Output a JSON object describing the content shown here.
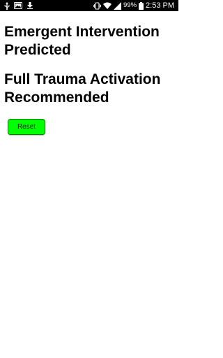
{
  "status_bar": {
    "battery_percent": "99%",
    "time": "2:53 PM",
    "icons_left": [
      "usb-icon",
      "image-icon",
      "download-icon"
    ],
    "icons_right": [
      "vibrate-icon",
      "wifi-icon",
      "signal-icon",
      "battery-icon"
    ]
  },
  "main": {
    "heading_1": "Emergent Intervention Predicted",
    "heading_2": "Full Trauma Activation Recommended",
    "reset_label": "Reset"
  },
  "colors": {
    "reset_button_bg": "#00ff00",
    "status_bar_bg": "#000000",
    "text": "#000000"
  }
}
